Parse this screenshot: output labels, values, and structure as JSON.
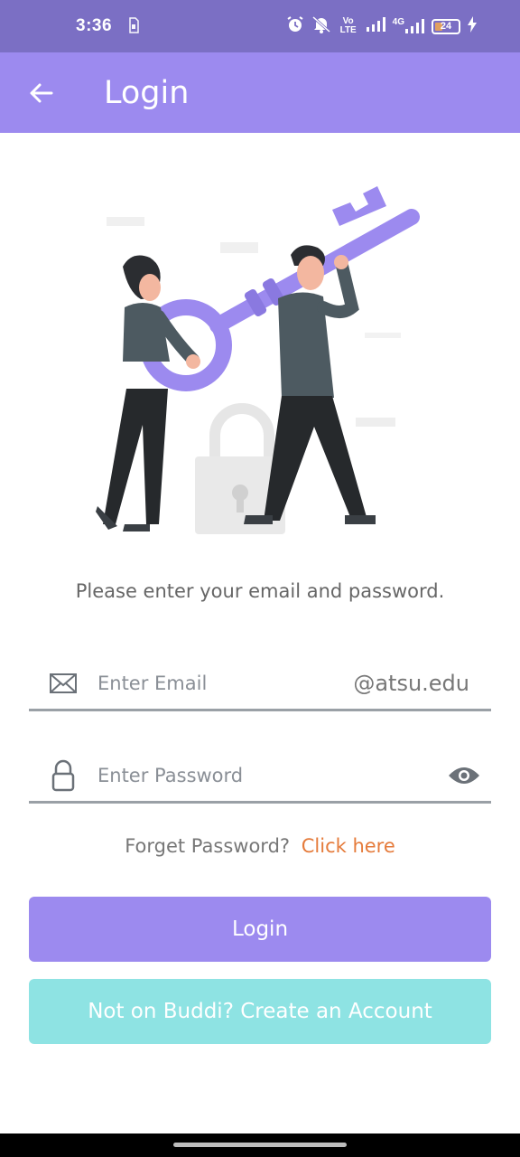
{
  "status_bar": {
    "time": "3:36",
    "sim_icon": "sim-card-icon",
    "icons": [
      "alarm-icon",
      "mute-icon",
      "volte-icon",
      "signal-icon",
      "4g-signal-icon",
      "battery-icon",
      "charging-icon"
    ],
    "volte_label": "Vo\nLTE",
    "network_label": "4G",
    "battery_level": "24"
  },
  "app_bar": {
    "title": "Login",
    "back_icon": "arrow-left-icon",
    "background": "#9c8aef"
  },
  "illustration": {
    "description_icon": "people-carrying-key-illustration",
    "accent_color": "#9c8aef"
  },
  "prompt": "Please enter your email and password.",
  "email_field": {
    "icon": "envelope-icon",
    "placeholder": "Enter Email",
    "value": "",
    "suffix": "@atsu.edu"
  },
  "password_field": {
    "icon": "lock-icon",
    "placeholder": "Enter Password",
    "value": "",
    "toggle_icon": "eye-icon"
  },
  "forgot": {
    "text": "Forget Password?",
    "link": "Click here",
    "link_color": "#e57b3b"
  },
  "buttons": {
    "login": "Login",
    "create_account": "Not on Buddi? Create an Account",
    "login_color": "#9c8aef",
    "create_color": "#8ee3e3"
  }
}
